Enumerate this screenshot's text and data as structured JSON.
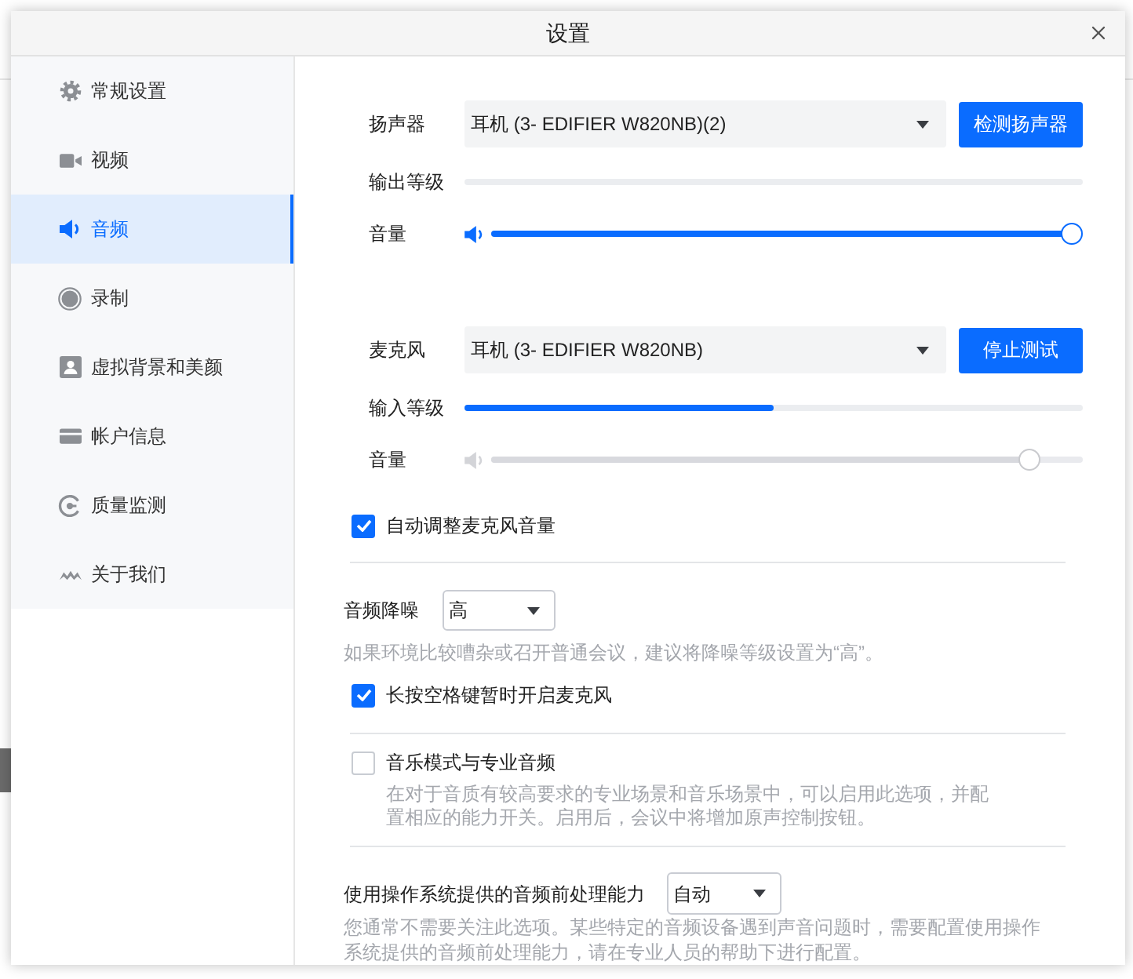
{
  "window": {
    "title": "设置"
  },
  "sidebar": {
    "items": [
      {
        "label": "常规设置",
        "selected": false
      },
      {
        "label": "视频",
        "selected": false
      },
      {
        "label": "音频",
        "selected": true
      },
      {
        "label": "录制",
        "selected": false
      },
      {
        "label": "虚拟背景和美颜",
        "selected": false
      },
      {
        "label": "帐户信息",
        "selected": false
      },
      {
        "label": "质量监测",
        "selected": false
      },
      {
        "label": "关于我们",
        "selected": false
      }
    ]
  },
  "speaker": {
    "label": "扬声器",
    "device": "耳机 (3- EDIFIER W820NB)(2)",
    "button": "检测扬声器",
    "output_level": {
      "label": "输出等级",
      "level": 0
    },
    "volume": {
      "label": "音量",
      "level": 1,
      "disabled": false
    }
  },
  "microphone": {
    "label": "麦克风",
    "device": "耳机 (3- EDIFIER W820NB)",
    "button": "停止测试",
    "input_level": {
      "label": "输入等级",
      "level": 0.5
    },
    "volume": {
      "label": "音量",
      "level": 0.925,
      "disabled": true
    }
  },
  "auto_adjust": {
    "label": "自动调整麦克风音量",
    "checked": true
  },
  "noise_suppression": {
    "label": "音频降噪",
    "value": "高",
    "hint": "如果环境比较嘈杂或召开普通会议，建议将降噪等级设置为“高”。"
  },
  "push_to_talk": {
    "label": "长按空格键暂时开启麦克风",
    "checked": true
  },
  "music_mode": {
    "label": "音乐模式与专业音频",
    "checked": false,
    "description": "在对于音质有较高要求的专业场景和音乐场景中，可以启用此选项，并配置相应的能力开关。启用后，会议中将增加原声控制按钮。"
  },
  "system_processing": {
    "label": "使用操作系统提供的音频前处理能力",
    "value": "自动",
    "hint": "您通常不需要关注此选项。某些特定的音频设备遇到声音问题时，需要配置使用操作系统提供的音频前处理能力，请在专业人员的帮助下进行配置。"
  }
}
